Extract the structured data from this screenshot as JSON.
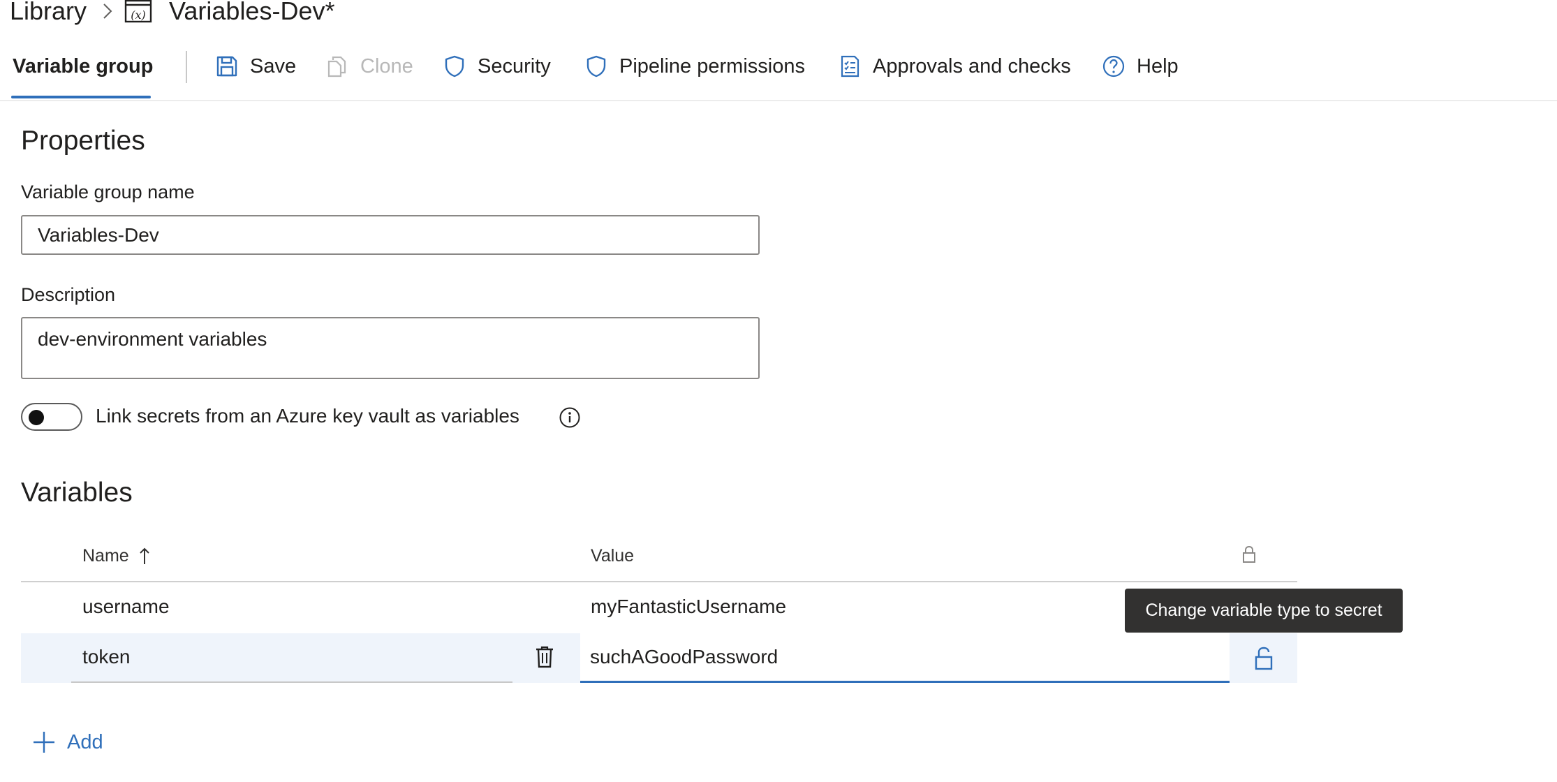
{
  "breadcrumb": {
    "root": "Library",
    "current": "Variables-Dev*",
    "current_icon": "variable-group-icon"
  },
  "toolbar": {
    "active_tab": "Variable group",
    "items": [
      {
        "label": "Save",
        "icon": "save-icon",
        "disabled": false
      },
      {
        "label": "Clone",
        "icon": "clone-icon",
        "disabled": true
      },
      {
        "label": "Security",
        "icon": "shield-icon",
        "disabled": false
      },
      {
        "label": "Pipeline permissions",
        "icon": "shield-icon",
        "disabled": false
      },
      {
        "label": "Approvals and checks",
        "icon": "checklist-icon",
        "disabled": false
      },
      {
        "label": "Help",
        "icon": "help-icon",
        "disabled": false
      }
    ]
  },
  "properties": {
    "heading": "Properties",
    "name_label": "Variable group name",
    "name_value": "Variables-Dev",
    "description_label": "Description",
    "description_value": "dev-environment variables",
    "keyvault_toggle_label": "Link secrets from an Azure key vault as variables",
    "keyvault_toggle_on": false
  },
  "variables": {
    "heading": "Variables",
    "columns": {
      "name": "Name",
      "name_sort": "ascending",
      "value": "Value",
      "secret_icon": "lock-icon"
    },
    "rows": [
      {
        "name": "username",
        "value": "myFantasticUsername",
        "secret": false
      },
      {
        "name": "token",
        "value": "suchAGoodPassword",
        "secret": false,
        "editing": true
      }
    ],
    "add_label": "Add"
  },
  "tooltip": {
    "text": "Change variable type to secret"
  },
  "colors": {
    "accent": "#2f6fba",
    "selected_row": "#eff4fb",
    "tooltip_bg": "#323130"
  }
}
